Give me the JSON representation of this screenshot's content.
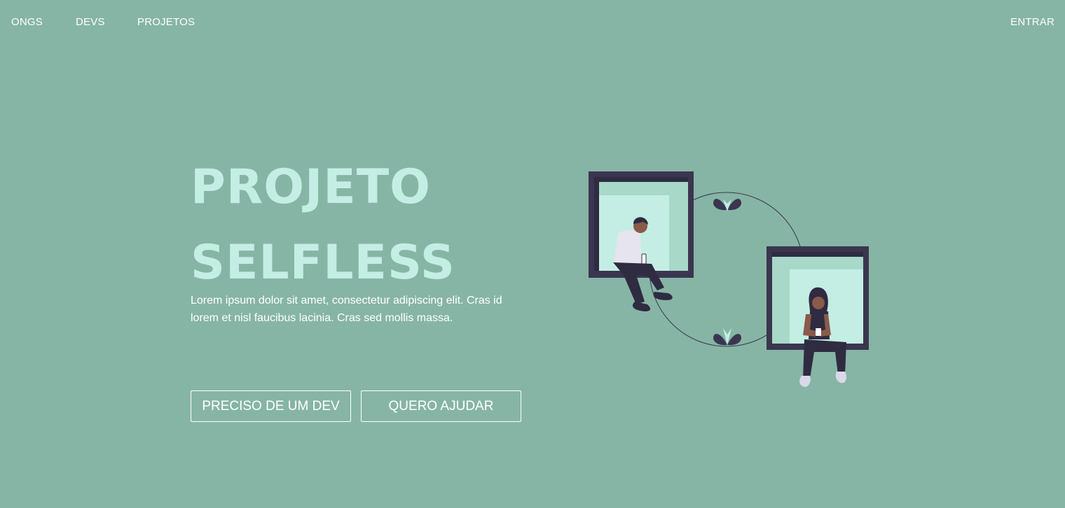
{
  "nav": {
    "links": [
      {
        "label": "ONGS"
      },
      {
        "label": "DEVS"
      },
      {
        "label": "PROJETOS"
      }
    ],
    "login_label": "ENTRAR"
  },
  "hero": {
    "title_line1": "PROJETO",
    "title_line2": "SELFLESS",
    "description": "Lorem ipsum dolor sit amet, consectetur adipiscing elit. Cras id lorem et nisl faucibus lacinia. Cras sed mollis massa.",
    "buttons": {
      "need_dev": "PRECISO DE UM DEV",
      "want_help": "QUERO AJUDAR"
    }
  },
  "colors": {
    "background": "#86b5a5",
    "title": "#c4eee3",
    "frame": "#3b3650",
    "window_light": "#c4eee3"
  },
  "illustration": {
    "icon": "people-in-windows-illustration"
  }
}
